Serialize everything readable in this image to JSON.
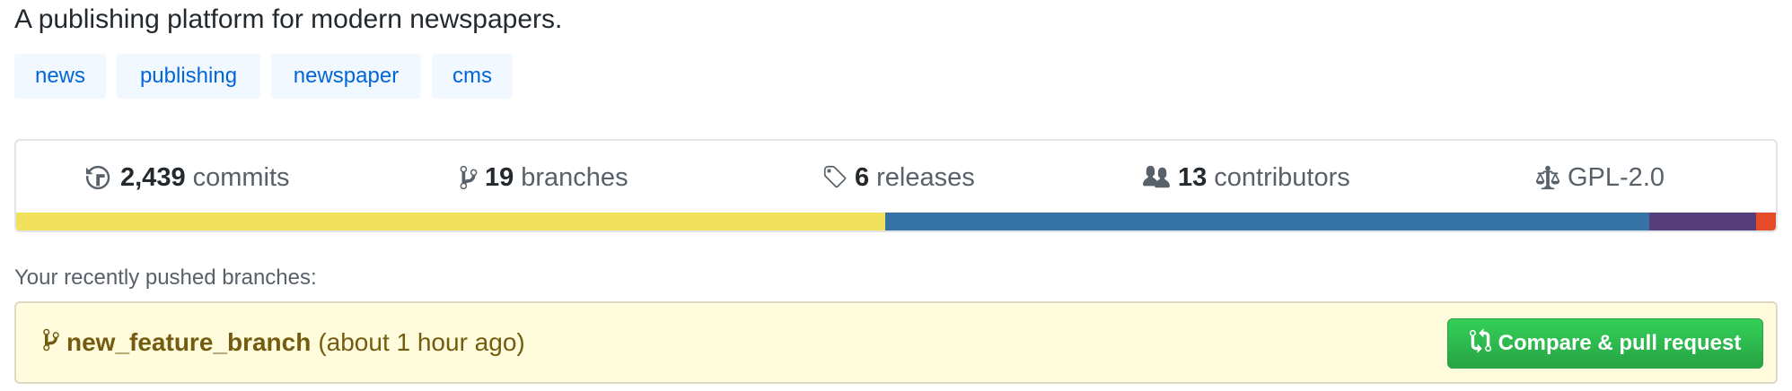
{
  "repo": {
    "description": "A publishing platform for modern newspapers."
  },
  "topics": [
    "news",
    "publishing",
    "newspaper",
    "cms"
  ],
  "stats": {
    "commits": {
      "count": "2,439",
      "label": "commits",
      "icon": "history-icon"
    },
    "branches": {
      "count": "19",
      "label": "branches",
      "icon": "git-branch-icon"
    },
    "releases": {
      "count": "6",
      "label": "releases",
      "icon": "tag-icon"
    },
    "contributors": {
      "count": "13",
      "label": "contributors",
      "icon": "people-icon"
    },
    "license": {
      "label": "GPL-2.0",
      "icon": "law-icon"
    }
  },
  "languages": [
    {
      "color": "#f1e05a",
      "percent": 49.4
    },
    {
      "color": "#3572A5",
      "percent": 43.4
    },
    {
      "color": "#563d7c",
      "percent": 6.1
    },
    {
      "color": "#e34c26",
      "percent": 1.1
    }
  ],
  "recent_push": {
    "heading": "Your recently pushed branches:",
    "branch": "new_feature_branch",
    "time": "(about 1 hour ago)",
    "button_label": "Compare & pull request"
  },
  "colors": {
    "link": "#0366d6",
    "topic_bg": "#f1f8ff",
    "notice_bg": "#fffbdd",
    "notice_text": "#735c0f",
    "button_green": "#28a745"
  }
}
